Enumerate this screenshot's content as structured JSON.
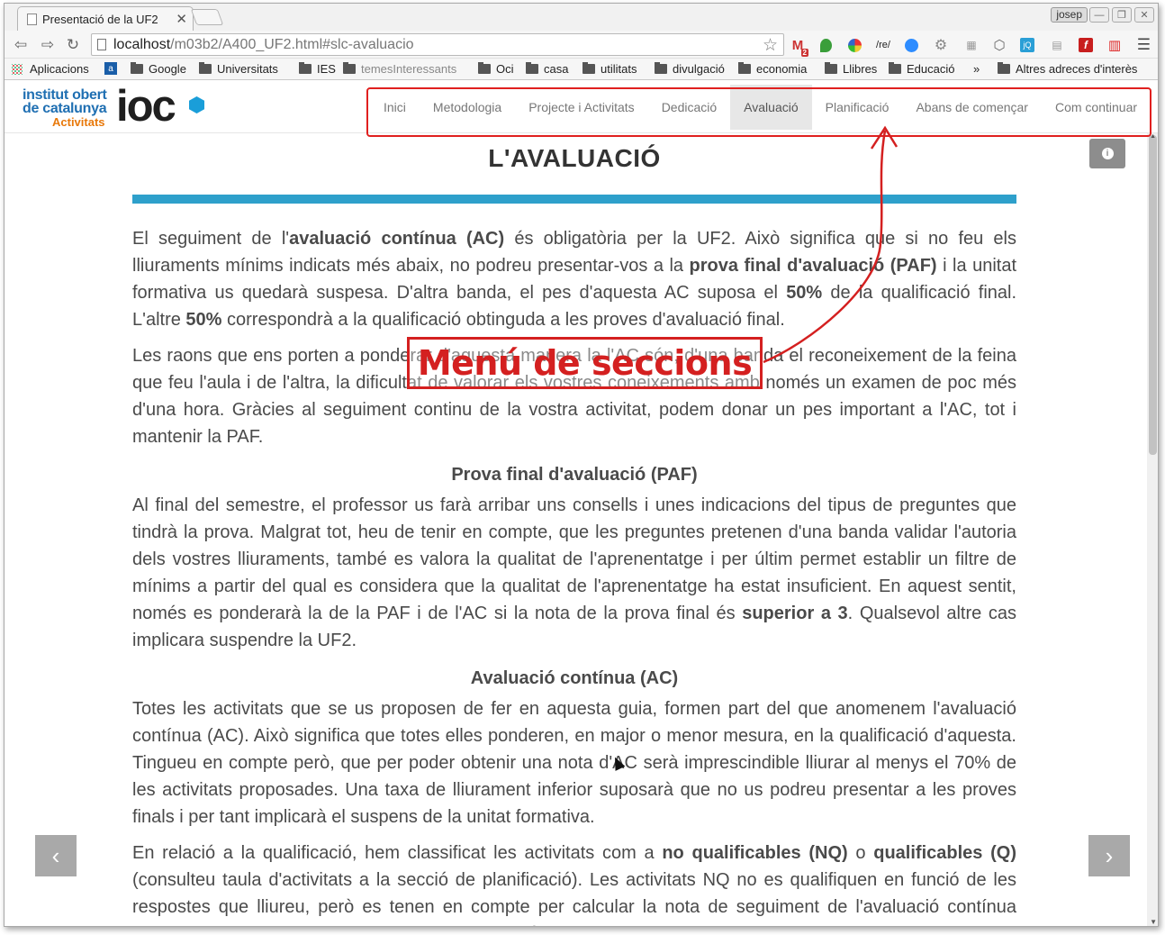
{
  "browser": {
    "tab_title": "Presentació de la UF2",
    "tab_close": "✕",
    "user": "josep",
    "window_buttons": [
      "—",
      "❐",
      "✕"
    ],
    "url_host": "localhost",
    "url_path": "/m03b2/A400_UF2.html#slc-avaluacio",
    "gmail_count": "2",
    "ext_re_label": "/re/",
    "ext_jq_label": "jQ",
    "ext_flash_label": "f"
  },
  "bookmarks": {
    "apps": "Aplicacions",
    "amazon_icon": "a",
    "items": [
      "Google",
      "Universitats",
      "IES",
      "temesInteressants",
      "Oci",
      "casa",
      "utilitats",
      "divulgació",
      "economia",
      "Llibres",
      "Educació"
    ],
    "more": "»",
    "other": "Altres adreces d'interès"
  },
  "logo": {
    "line1": "institut obert",
    "line2": "de catalunya",
    "line3": "Activitats",
    "brand": "ioc"
  },
  "nav": {
    "items": [
      "Inici",
      "Metodologia",
      "Projecte i Activitats",
      "Dedicació",
      "Avaluació",
      "Planificació",
      "Abans de començar",
      "Com continuar"
    ],
    "active_index": 4
  },
  "info_icon": "i",
  "page": {
    "title": "L'AVALUACIÓ",
    "p1": {
      "a": "El seguiment de l'",
      "b1": "avaluació contínua (AC)",
      "c": " és obligatòria per la UF2. Això significa que si no feu els lliuraments mínims indicats més abaix, no podreu presentar-vos a la ",
      "b2": "prova final d'avaluació (PAF)",
      "d": " i la unitat formativa us quedarà suspesa. D'altra banda, el pes d'aquesta AC suposa el ",
      "b3": "50%",
      "e": " de la qualificació final. L'altre ",
      "b4": "50%",
      "f": " correspondrà a la qualificació obtinguda a les proves d'avaluació final."
    },
    "p2": "Les raons que ens porten a ponderar d'aquesta manera la l'AC són, d'una banda el reconeixement de la feina que feu l'aula i de l'altra, la dificultat de valorar els vostres coneixements amb només un examen de poc més d'una hora. Gràcies al seguiment continu de la vostra activitat, podem donar un pes important a l'AC, tot i mantenir la PAF.",
    "h_paf": "Prova final d'avaluació (PAF)",
    "p3": {
      "a": "Al final del semestre, el professor us farà arribar uns consells i unes indicacions del tipus de preguntes que tindrà la prova. Malgrat tot, heu de tenir en compte, que les preguntes pretenen d'una banda validar l'autoria dels vostres lliuraments, també es valora la qualitat de l'aprenentatge i per últim permet establir un filtre de mínims a partir del qual es considera que la qualitat de l'aprenentatge ha estat insuficient. En aquest sentit, només es ponderarà la de la PAF i de l'AC si la nota de la prova final és ",
      "b": "superior a 3",
      "c": ". Qualsevol altre cas implicara suspendre la UF2."
    },
    "h_ac": "Avaluació contínua (AC)",
    "p4": "Totes les activitats que se us proposen de fer en aquesta guia, formen part del que anomenem l'avaluació contínua (AC). Això significa que totes elles ponderen, en major o menor mesura, en la qualificació d'aquesta. Tingueu en compte però, que per poder obtenir una nota d'AC serà imprescindible lliurar al menys el 70% de les activitats proposades. Una taxa de lliurament inferior suposarà que no us podreu presentar a les proves finals i per tant implicarà el suspens de la unitat formativa.",
    "p5": {
      "a": "En relació a la qualificació, hem classificat les activitats com a ",
      "b1": "no qualificables (NQ)",
      "c": " o ",
      "b2": "qualificables (Q)",
      "d": " (consulteu taula d'activitats a la secció de planificació). Les activitats NQ no es qualifiquen en funció de les respostes que lliureu, però es tenen en compte per calcular la nota de seguiment de l'avaluació contínua (SAC). La nota de seguiment es calcula usant la fórmula següent:"
    }
  },
  "annotation": {
    "label": "Menú de seccions",
    "color": "#d42020"
  },
  "pager": {
    "prev": "‹",
    "next": "›"
  }
}
